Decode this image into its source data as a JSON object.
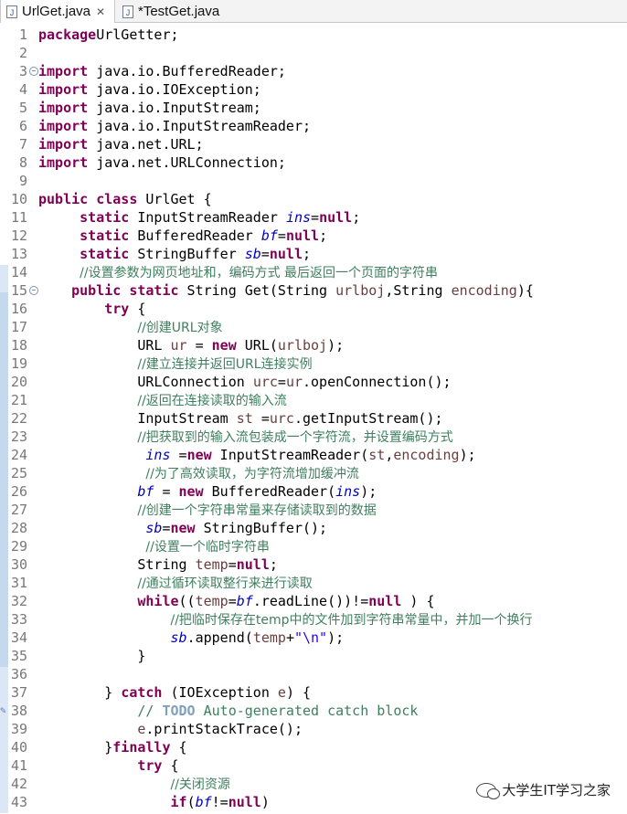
{
  "tabs": [
    {
      "label": "UrlGet.java",
      "icon": "java-file-icon",
      "active": true,
      "closable": true
    },
    {
      "label": "*TestGet.java",
      "icon": "java-file-icon",
      "active": false,
      "closable": false
    }
  ],
  "watermark": {
    "text": "大学生IT学习之家",
    "icon": "wechat-icon"
  },
  "code_lines": [
    {
      "n": "1",
      "segs": [
        [
          "kw",
          "package"
        ],
        [
          "",
          "UrlGetter;"
        ]
      ]
    },
    {
      "n": "2",
      "segs": []
    },
    {
      "n": "3",
      "fold": true,
      "segs": [
        [
          "kw",
          "import"
        ],
        [
          "",
          " java.io.BufferedReader;"
        ]
      ]
    },
    {
      "n": "4",
      "segs": [
        [
          "kw",
          "import"
        ],
        [
          "",
          " java.io.IOException;"
        ]
      ]
    },
    {
      "n": "5",
      "segs": [
        [
          "kw",
          "import"
        ],
        [
          "",
          " java.io.InputStream;"
        ]
      ]
    },
    {
      "n": "6",
      "segs": [
        [
          "kw",
          "import"
        ],
        [
          "",
          " java.io.InputStreamReader;"
        ]
      ]
    },
    {
      "n": "7",
      "segs": [
        [
          "kw",
          "import"
        ],
        [
          "",
          " java.net.URL;"
        ]
      ]
    },
    {
      "n": "8",
      "segs": [
        [
          "kw",
          "import"
        ],
        [
          "",
          " java.net.URLConnection;"
        ]
      ]
    },
    {
      "n": "9",
      "segs": []
    },
    {
      "n": "10",
      "segs": [
        [
          "kw",
          "public class"
        ],
        [
          "",
          " UrlGet {"
        ]
      ]
    },
    {
      "n": "11",
      "segs": [
        [
          "",
          "     "
        ],
        [
          "kw",
          "static"
        ],
        [
          "",
          " InputStreamReader "
        ],
        [
          "fld",
          "ins"
        ],
        [
          "",
          "="
        ],
        [
          "kw",
          "null"
        ],
        [
          "",
          ";"
        ]
      ]
    },
    {
      "n": "12",
      "segs": [
        [
          "",
          "     "
        ],
        [
          "kw",
          "static"
        ],
        [
          "",
          " BufferedReader "
        ],
        [
          "fld",
          "bf"
        ],
        [
          "",
          "="
        ],
        [
          "kw",
          "null"
        ],
        [
          "",
          ";"
        ]
      ]
    },
    {
      "n": "13",
      "segs": [
        [
          "",
          "     "
        ],
        [
          "kw",
          "static"
        ],
        [
          "",
          " StringBuffer "
        ],
        [
          "fld",
          "sb"
        ],
        [
          "",
          "="
        ],
        [
          "kw",
          "null"
        ],
        [
          "",
          ";"
        ]
      ]
    },
    {
      "n": "14",
      "segs": [
        [
          "",
          "     "
        ],
        [
          "cm zh",
          "//设置参数为网页地址和，编码方式 最后返回一个页面的字符串"
        ]
      ]
    },
    {
      "n": "15",
      "fold": true,
      "segs": [
        [
          "",
          "    "
        ],
        [
          "kw",
          "public static"
        ],
        [
          "",
          " String Get(String "
        ],
        [
          "var",
          "urlboj"
        ],
        [
          "",
          ",String "
        ],
        [
          "var",
          "encoding"
        ],
        [
          "",
          "){"
        ]
      ]
    },
    {
      "n": "16",
      "segs": [
        [
          "",
          "        "
        ],
        [
          "kw",
          "try"
        ],
        [
          "",
          " {"
        ]
      ]
    },
    {
      "n": "17",
      "segs": [
        [
          "",
          "            "
        ],
        [
          "cm zh",
          "//创建URL对象"
        ]
      ]
    },
    {
      "n": "18",
      "segs": [
        [
          "",
          "            URL "
        ],
        [
          "var",
          "ur"
        ],
        [
          "",
          " = "
        ],
        [
          "kw",
          "new"
        ],
        [
          "",
          " URL("
        ],
        [
          "var",
          "urlboj"
        ],
        [
          "",
          ");"
        ]
      ]
    },
    {
      "n": "19",
      "segs": [
        [
          "",
          "            "
        ],
        [
          "cm zh",
          "//建立连接并返回URL连接实例"
        ]
      ]
    },
    {
      "n": "20",
      "segs": [
        [
          "",
          "            URLConnection "
        ],
        [
          "var",
          "urc"
        ],
        [
          "",
          "="
        ],
        [
          "var",
          "ur"
        ],
        [
          "",
          ".openConnection();"
        ]
      ]
    },
    {
      "n": "21",
      "segs": [
        [
          "",
          "            "
        ],
        [
          "cm zh",
          "//返回在连接读取的输入流"
        ]
      ]
    },
    {
      "n": "22",
      "segs": [
        [
          "",
          "            InputStream "
        ],
        [
          "var",
          "st"
        ],
        [
          "",
          " ="
        ],
        [
          "var",
          "urc"
        ],
        [
          "",
          ".getInputStream();"
        ]
      ]
    },
    {
      "n": "23",
      "segs": [
        [
          "",
          "            "
        ],
        [
          "cm zh",
          "//把获取到的输入流包装成一个字符流，并设置编码方式"
        ]
      ]
    },
    {
      "n": "24",
      "segs": [
        [
          "",
          "             "
        ],
        [
          "fld",
          "ins"
        ],
        [
          "",
          " ="
        ],
        [
          "kw",
          "new"
        ],
        [
          "",
          " InputStreamReader("
        ],
        [
          "var",
          "st"
        ],
        [
          "",
          ","
        ],
        [
          "var",
          "encoding"
        ],
        [
          "",
          ");"
        ]
      ]
    },
    {
      "n": "25",
      "segs": [
        [
          "",
          "             "
        ],
        [
          "cm zh",
          "//为了高效读取，为字符流增加缓冲流"
        ]
      ]
    },
    {
      "n": "26",
      "segs": [
        [
          "",
          "            "
        ],
        [
          "fld",
          "bf"
        ],
        [
          "",
          " = "
        ],
        [
          "kw",
          "new"
        ],
        [
          "",
          " BufferedReader("
        ],
        [
          "fld",
          "ins"
        ],
        [
          "",
          ");"
        ]
      ]
    },
    {
      "n": "27",
      "segs": [
        [
          "",
          "            "
        ],
        [
          "cm zh",
          "//创建一个字符串常量来存储读取到的数据"
        ]
      ]
    },
    {
      "n": "28",
      "segs": [
        [
          "",
          "             "
        ],
        [
          "fld",
          "sb"
        ],
        [
          "",
          "="
        ],
        [
          "kw",
          "new"
        ],
        [
          "",
          " StringBuffer();"
        ]
      ]
    },
    {
      "n": "29",
      "segs": [
        [
          "",
          "             "
        ],
        [
          "cm zh",
          "//设置一个临时字符串"
        ]
      ]
    },
    {
      "n": "30",
      "segs": [
        [
          "",
          "            String "
        ],
        [
          "var",
          "temp"
        ],
        [
          "",
          "="
        ],
        [
          "kw",
          "null"
        ],
        [
          "",
          ";"
        ]
      ]
    },
    {
      "n": "31",
      "segs": [
        [
          "",
          "            "
        ],
        [
          "cm zh",
          "//通过循环读取整行来进行读取"
        ]
      ]
    },
    {
      "n": "32",
      "segs": [
        [
          "",
          "            "
        ],
        [
          "kw",
          "while"
        ],
        [
          "",
          "(("
        ],
        [
          "var",
          "temp"
        ],
        [
          "",
          "="
        ],
        [
          "fld",
          "bf"
        ],
        [
          "",
          ".readLine())!="
        ],
        [
          "kw",
          "null"
        ],
        [
          "",
          " ) {"
        ]
      ]
    },
    {
      "n": "33",
      "segs": [
        [
          "",
          "                "
        ],
        [
          "cm zh",
          "//把临时保存在temp中的文件加到字符串常量中，并加一个换行"
        ]
      ]
    },
    {
      "n": "34",
      "segs": [
        [
          "",
          "                "
        ],
        [
          "fld",
          "sb"
        ],
        [
          "",
          ".append("
        ],
        [
          "var",
          "temp"
        ],
        [
          "",
          "+"
        ],
        [
          "str",
          "\"\\n\""
        ],
        [
          "",
          ");"
        ]
      ]
    },
    {
      "n": "35",
      "segs": [
        [
          "",
          "            }"
        ]
      ]
    },
    {
      "n": "36",
      "segs": []
    },
    {
      "n": "37",
      "segs": [
        [
          "",
          "        } "
        ],
        [
          "kw",
          "catch"
        ],
        [
          "",
          " (IOException "
        ],
        [
          "var",
          "e"
        ],
        [
          "",
          ") {"
        ]
      ]
    },
    {
      "n": "38",
      "warn": true,
      "segs": [
        [
          "",
          "            "
        ],
        [
          "cm",
          "// "
        ],
        [
          "todo",
          "TODO"
        ],
        [
          "cm",
          " Auto-generated catch block"
        ]
      ]
    },
    {
      "n": "39",
      "segs": [
        [
          "",
          "            "
        ],
        [
          "var",
          "e"
        ],
        [
          "",
          ".printStackTrace();"
        ]
      ]
    },
    {
      "n": "40",
      "segs": [
        [
          "",
          "        }"
        ],
        [
          "kw",
          "finally"
        ],
        [
          "",
          " {"
        ]
      ]
    },
    {
      "n": "41",
      "segs": [
        [
          "",
          "            "
        ],
        [
          "kw",
          "try"
        ],
        [
          "",
          " {"
        ]
      ]
    },
    {
      "n": "42",
      "segs": [
        [
          "",
          "                "
        ],
        [
          "cm zh",
          "//关闭资源"
        ]
      ]
    },
    {
      "n": "43",
      "segs": [
        [
          "",
          "                "
        ],
        [
          "kw",
          "if"
        ],
        [
          "",
          "("
        ],
        [
          "fld",
          "bf"
        ],
        [
          "",
          "!="
        ],
        [
          "kw",
          "null"
        ],
        [
          "",
          ")"
        ]
      ]
    }
  ]
}
